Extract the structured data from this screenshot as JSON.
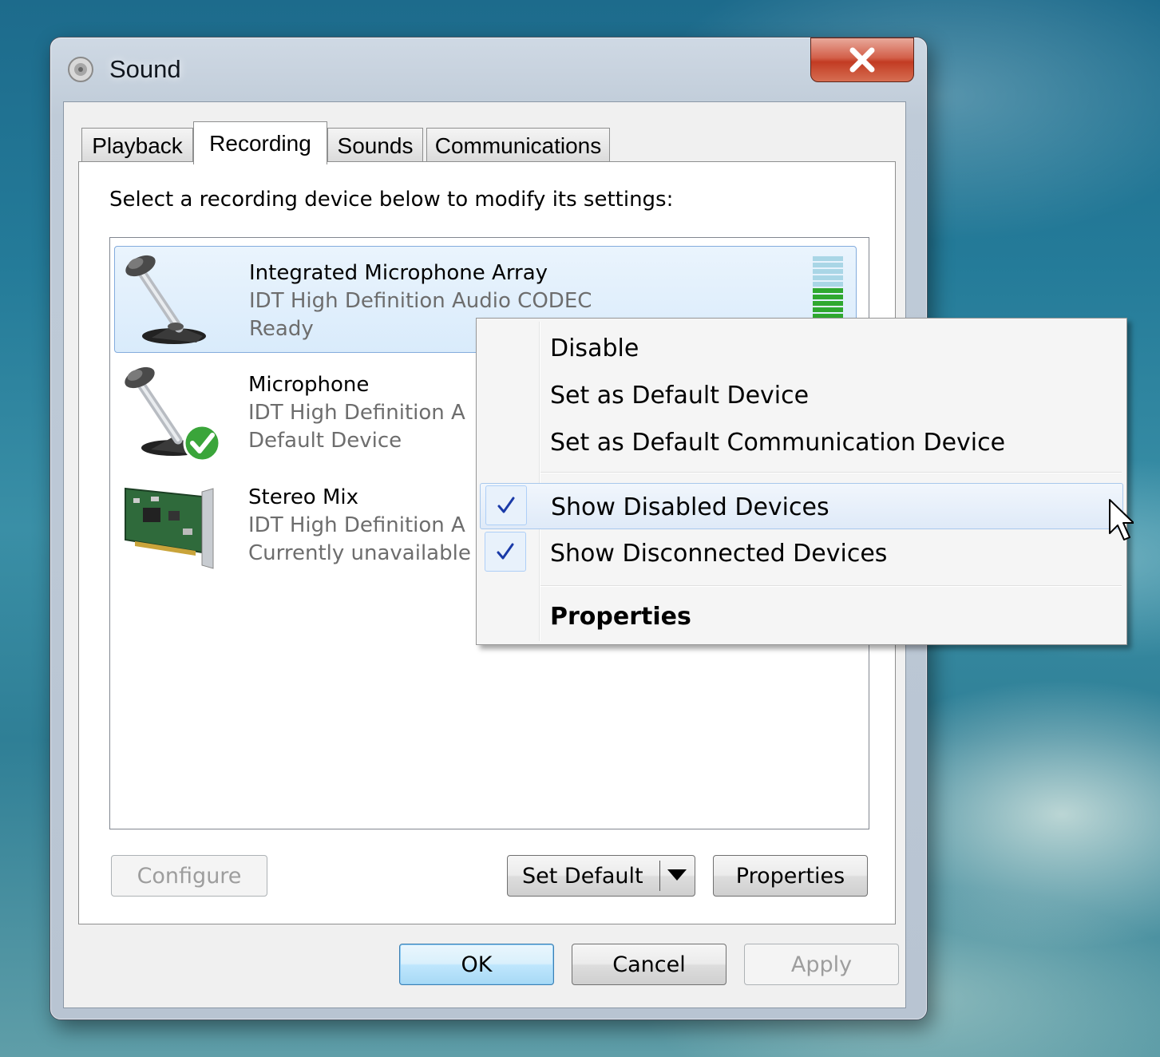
{
  "window": {
    "title": "Sound",
    "icon": "speaker-icon",
    "close_icon": "close-icon"
  },
  "tabs": [
    {
      "label": "Playback",
      "active": false
    },
    {
      "label": "Recording",
      "active": true
    },
    {
      "label": "Sounds",
      "active": false
    },
    {
      "label": "Communications",
      "active": false
    }
  ],
  "panel": {
    "hint": "Select a recording device below to modify its settings:"
  },
  "devices": [
    {
      "name": "Integrated Microphone Array",
      "driver": "IDT High Definition Audio CODEC",
      "status": "Ready",
      "icon": "microphone-icon",
      "selected": true
    },
    {
      "name": "Microphone",
      "driver": "IDT High Definition A",
      "status": "Default Device",
      "icon": "microphone-default-icon",
      "selected": false
    },
    {
      "name": "Stereo Mix",
      "driver": "IDT High Definition A",
      "status": "Currently unavailable",
      "icon": "sound-card-icon",
      "selected": false
    }
  ],
  "level_meter": {
    "filled_fraction": 0.5,
    "active_color": "#2fa82f",
    "inactive_color": "#a9d6e6"
  },
  "panel_buttons": {
    "configure": "Configure",
    "set_default": "Set Default",
    "properties": "Properties"
  },
  "dialog_buttons": {
    "ok": "OK",
    "cancel": "Cancel",
    "apply": "Apply"
  },
  "context_menu": {
    "items": [
      {
        "label": "Disable",
        "checked": false
      },
      {
        "label": "Set as Default Device",
        "checked": false
      },
      {
        "label": "Set as Default Communication Device",
        "checked": false
      },
      {
        "label": "Show Disabled Devices",
        "checked": true,
        "hover": true
      },
      {
        "label": "Show Disconnected Devices",
        "checked": true
      },
      {
        "label": "Properties",
        "checked": false,
        "bold": true
      }
    ]
  },
  "colors": {
    "selection": "#d9ebfb",
    "check": "#1a3aa8",
    "close_button": "#c23b22"
  }
}
